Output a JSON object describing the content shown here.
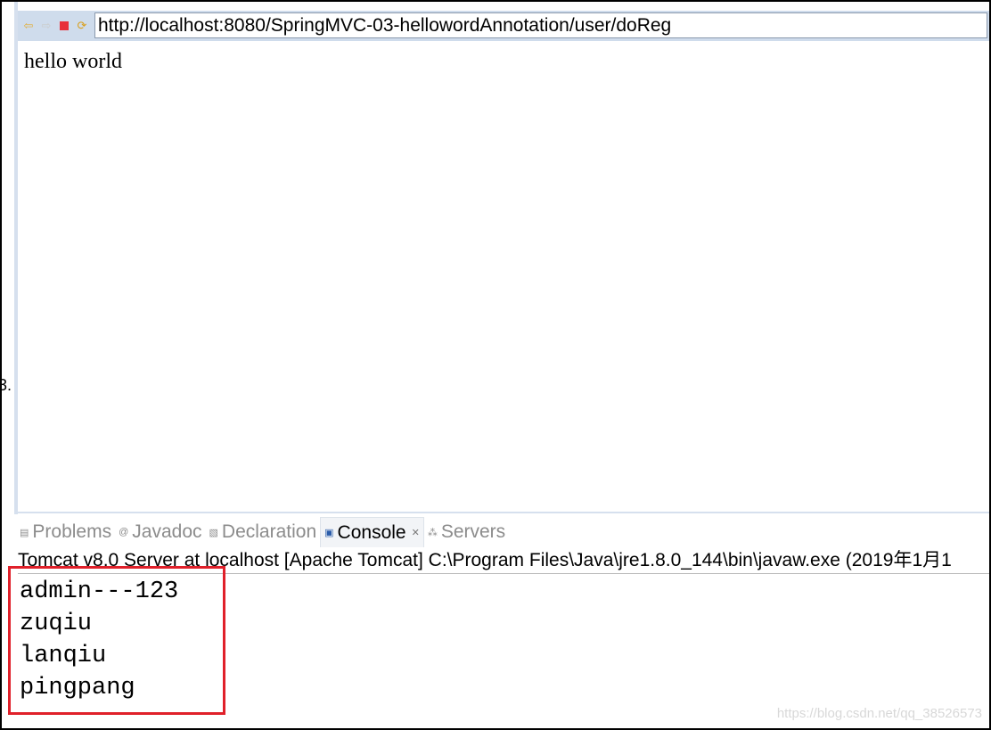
{
  "browser": {
    "url": "http://localhost:8080/SpringMVC-03-hellowordAnnotation/user/doReg",
    "content": "hello world",
    "icons": [
      "back-icon",
      "forward-icon",
      "stop-icon",
      "refresh-icon"
    ]
  },
  "stray_text": "3.",
  "panel": {
    "tabs": [
      {
        "label": "Problems",
        "icon": "problems-icon"
      },
      {
        "label": "Javadoc",
        "icon": "javadoc-icon"
      },
      {
        "label": "Declaration",
        "icon": "declaration-icon"
      },
      {
        "label": "Console",
        "icon": "console-icon",
        "active": true
      },
      {
        "label": "Servers",
        "icon": "servers-icon"
      }
    ],
    "header": "Tomcat v8.0 Server at localhost [Apache Tomcat] C:\\Program Files\\Java\\jre1.8.0_144\\bin\\javaw.exe (2019年1月1",
    "console_lines": [
      "admin---123",
      "zuqiu",
      "lanqiu",
      "pingpang"
    ]
  },
  "highlight_color": "#e0202a",
  "watermark": "https://blog.csdn.net/qq_38526573"
}
